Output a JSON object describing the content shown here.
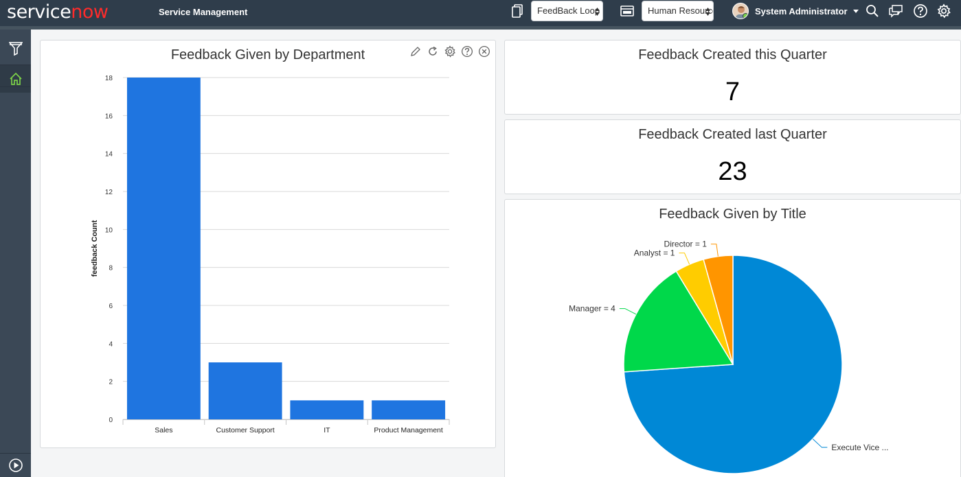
{
  "header": {
    "logo_part1": "service",
    "logo_part2": "now",
    "app_title": "Service Management",
    "select_dashboard": "FeedBack Loop",
    "select_domain": "Human Resources",
    "user_name": "System Administrator",
    "icons": [
      "copy-icon",
      "window-icon",
      "search-icon",
      "chat-icon",
      "help-icon",
      "gear-icon"
    ]
  },
  "leftnav": {
    "icons": [
      "filter-icon",
      "home-icon",
      "play-icon"
    ]
  },
  "dept_widget": {
    "title": "Feedback Given by Department",
    "tools": [
      "pencil-icon",
      "refresh-icon",
      "gear-icon",
      "help-icon",
      "close-icon"
    ]
  },
  "quarter_widget": {
    "title": "Feedback Created this Quarter",
    "value": "7"
  },
  "last_quarter_widget": {
    "title": "Feedback Created last Quarter",
    "value": "23"
  },
  "title_widget": {
    "title": "Feedback Given by Title"
  },
  "colors": {
    "header_bg": "#2f3d4b",
    "bar_color": "#1f75e0",
    "pie_colors": [
      "#0088d6",
      "#00d84a",
      "#ffcc00",
      "#ff9500"
    ]
  },
  "chart_data": [
    {
      "type": "bar",
      "title": "Feedback Given by Department",
      "categories": [
        "Sales",
        "Customer Support",
        "IT",
        "Product Management"
      ],
      "values": [
        18,
        3,
        1,
        1
      ],
      "ylabel": "feedback Count",
      "xlabel": "",
      "ylim": [
        0,
        18
      ],
      "yticks": [
        0,
        2,
        4,
        6,
        8,
        10,
        12,
        14,
        16,
        18
      ],
      "grid": true
    },
    {
      "type": "pie",
      "title": "Feedback Given by Title",
      "labels": [
        "Execute Vice ...",
        "Manager = 4",
        "Analyst = 1",
        "Director = 1"
      ],
      "values": [
        17,
        4,
        1,
        1
      ]
    }
  ]
}
